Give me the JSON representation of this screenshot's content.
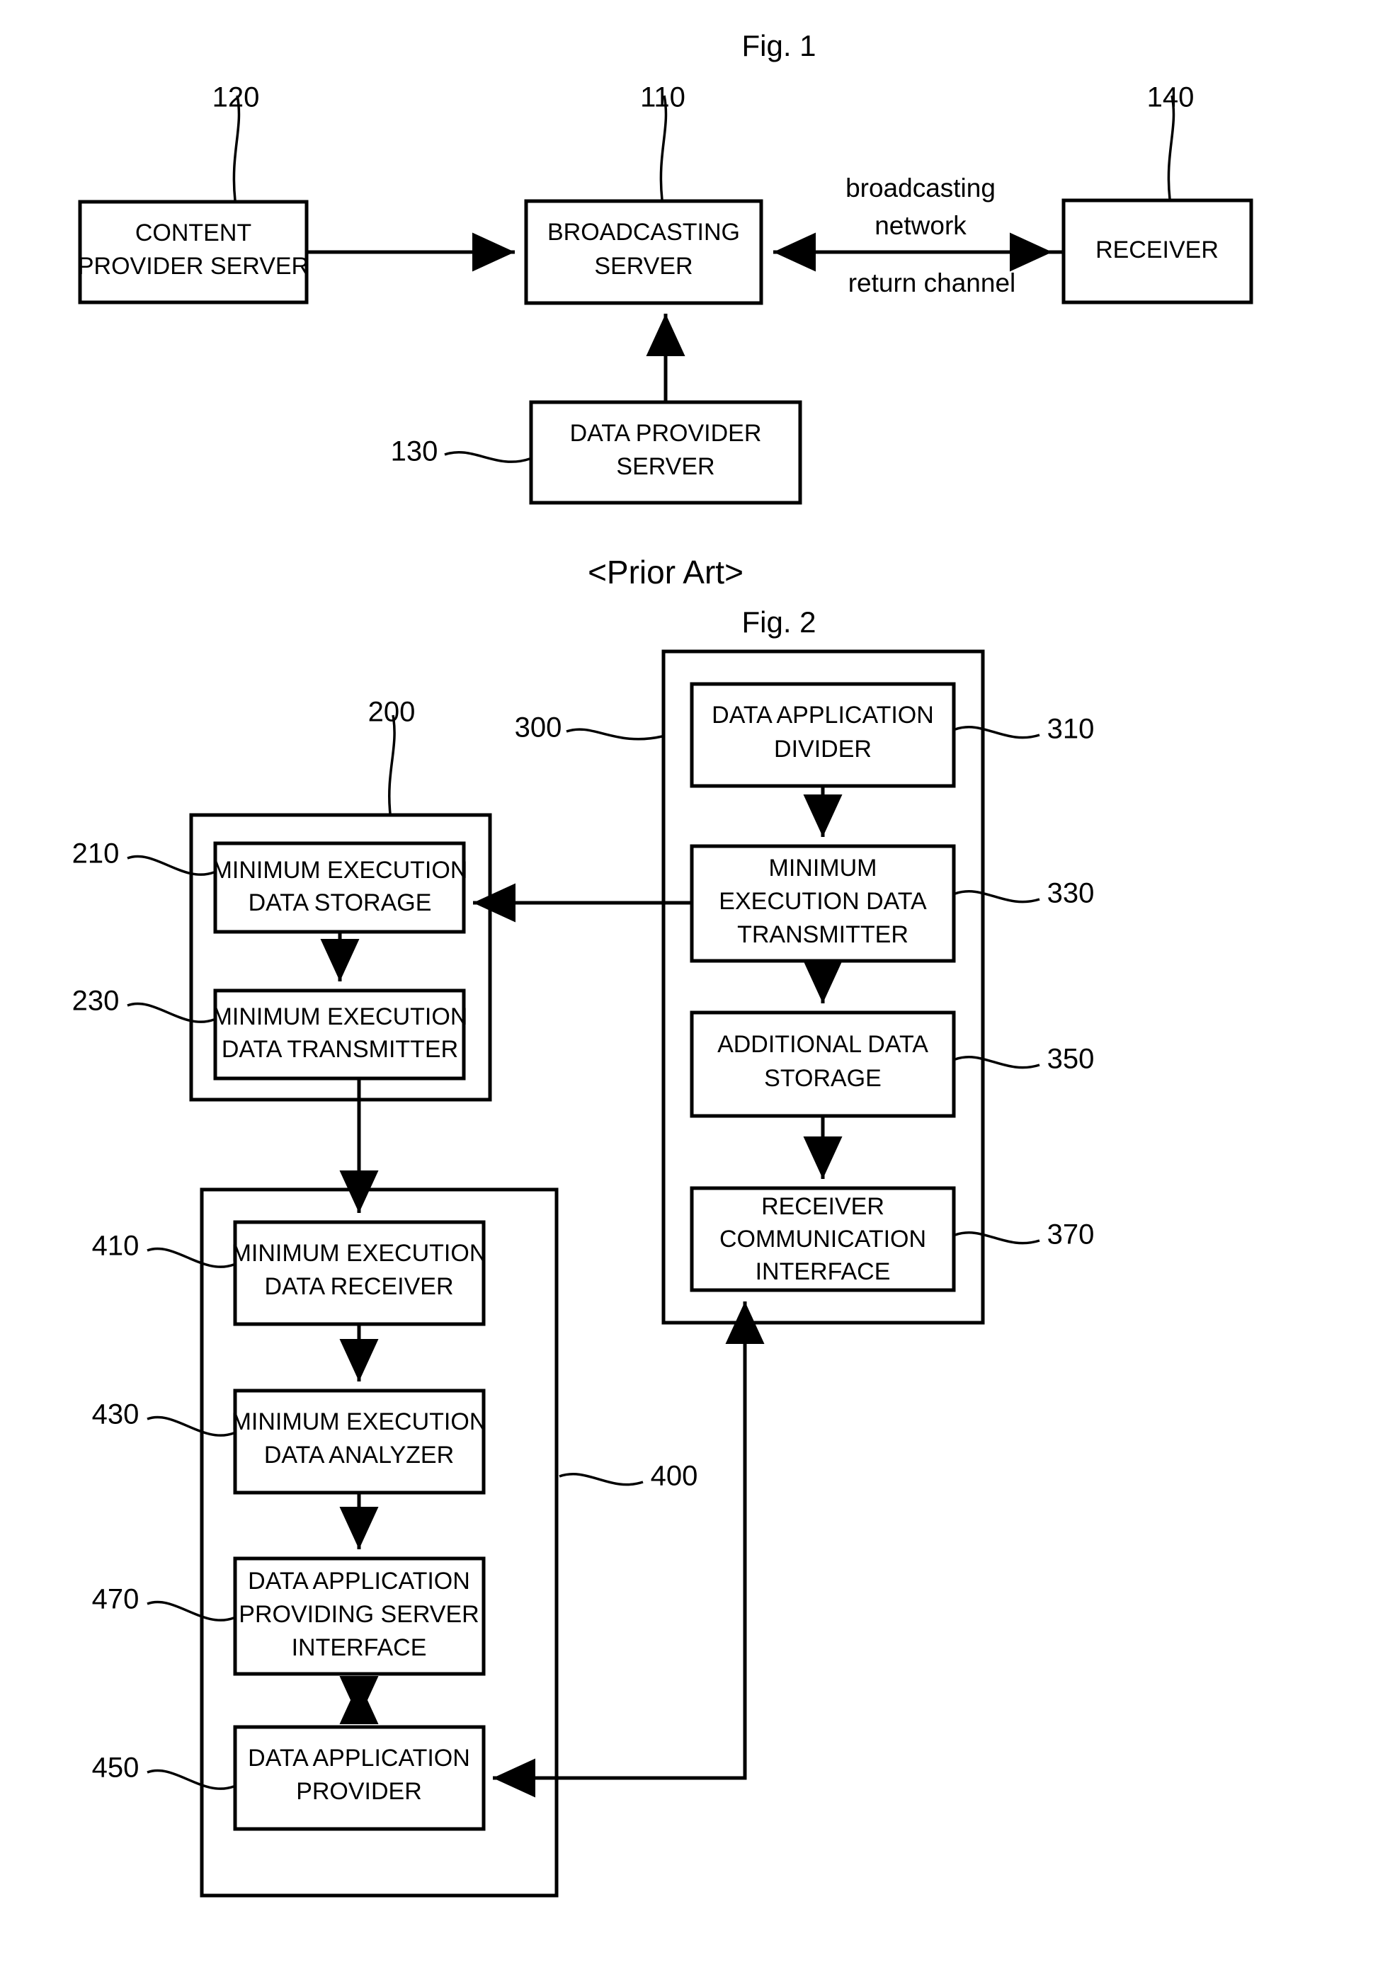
{
  "figures": [
    {
      "id": "fig1",
      "title": "Fig. 1",
      "subtitle": "<Prior Art>",
      "blocks": [
        {
          "ref": "120",
          "lines": [
            "CONTENT",
            "PROVIDER SERVER"
          ]
        },
        {
          "ref": "110",
          "lines": [
            "BROADCASTING",
            "SERVER"
          ]
        },
        {
          "ref": "140",
          "lines": [
            "RECEIVER"
          ]
        },
        {
          "ref": "130",
          "lines": [
            "DATA PROVIDER",
            "SERVER"
          ]
        }
      ],
      "edge_labels": [
        "broadcasting",
        "network",
        "return channel"
      ]
    },
    {
      "id": "fig2",
      "title": "Fig. 2",
      "containers": [
        {
          "ref": "200"
        },
        {
          "ref": "300"
        },
        {
          "ref": "400"
        }
      ],
      "blocks": [
        {
          "ref": "310",
          "lines": [
            "DATA APPLICATION",
            "DIVIDER"
          ]
        },
        {
          "ref": "330",
          "lines": [
            "MINIMUM",
            "EXECUTION DATA",
            "TRANSMITTER"
          ]
        },
        {
          "ref": "350",
          "lines": [
            "ADDITIONAL DATA",
            "STORAGE"
          ]
        },
        {
          "ref": "370",
          "lines": [
            "RECEIVER",
            "COMMUNICATION",
            "INTERFACE"
          ]
        },
        {
          "ref": "210",
          "lines": [
            "MINIMUM EXECUTION",
            "DATA STORAGE"
          ]
        },
        {
          "ref": "230",
          "lines": [
            "MINIMUM EXECUTION",
            "DATA TRANSMITTER"
          ]
        },
        {
          "ref": "410",
          "lines": [
            "MINIMUM EXECUTION",
            "DATA RECEIVER"
          ]
        },
        {
          "ref": "430",
          "lines": [
            "MINIMUM EXECUTION",
            "DATA ANALYZER"
          ]
        },
        {
          "ref": "470",
          "lines": [
            "DATA APPLICATION",
            "PROVIDING SERVER",
            "INTERFACE"
          ]
        },
        {
          "ref": "450",
          "lines": [
            "DATA APPLICATION",
            "PROVIDER"
          ]
        }
      ]
    }
  ],
  "fig1": {
    "title": "Fig. 1",
    "prior_art": "<Prior Art>",
    "content_provider_server": {
      "l1": "CONTENT",
      "l2": "PROVIDER SERVER",
      "ref": "120"
    },
    "broadcasting_server": {
      "l1": "BROADCASTING",
      "l2": "SERVER",
      "ref": "110"
    },
    "receiver": {
      "l1": "RECEIVER",
      "ref": "140"
    },
    "data_provider_server": {
      "l1": "DATA PROVIDER",
      "l2": "SERVER",
      "ref": "130"
    },
    "broadcasting_network_l1": "broadcasting",
    "broadcasting_network_l2": "network",
    "return_channel": "return channel"
  },
  "fig2": {
    "title": "Fig. 2",
    "container_200_ref": "200",
    "container_300_ref": "300",
    "container_400_ref": "400",
    "data_application_divider": {
      "l1": "DATA APPLICATION",
      "l2": "DIVIDER",
      "ref": "310"
    },
    "min_exec_data_transmitter_300": {
      "l1": "MINIMUM",
      "l2": "EXECUTION DATA",
      "l3": "TRANSMITTER",
      "ref": "330"
    },
    "additional_data_storage": {
      "l1": "ADDITIONAL DATA",
      "l2": "STORAGE",
      "ref": "350"
    },
    "receiver_communication_interface": {
      "l1": "RECEIVER",
      "l2": "COMMUNICATION",
      "l3": "INTERFACE",
      "ref": "370"
    },
    "min_exec_data_storage": {
      "l1": "MINIMUM EXECUTION",
      "l2": "DATA STORAGE",
      "ref": "210"
    },
    "min_exec_data_transmitter_200": {
      "l1": "MINIMUM EXECUTION",
      "l2": "DATA TRANSMITTER",
      "ref": "230"
    },
    "min_exec_data_receiver": {
      "l1": "MINIMUM EXECUTION",
      "l2": "DATA RECEIVER",
      "ref": "410"
    },
    "min_exec_data_analyzer": {
      "l1": "MINIMUM EXECUTION",
      "l2": "DATA ANALYZER",
      "ref": "430"
    },
    "data_app_providing_server_interface": {
      "l1": "DATA APPLICATION",
      "l2": "PROVIDING SERVER",
      "l3": "INTERFACE",
      "ref": "470"
    },
    "data_application_provider": {
      "l1": "DATA APPLICATION",
      "l2": "PROVIDER",
      "ref": "450"
    }
  },
  "colors": {
    "ink": "#000000",
    "paper": "#ffffff"
  }
}
